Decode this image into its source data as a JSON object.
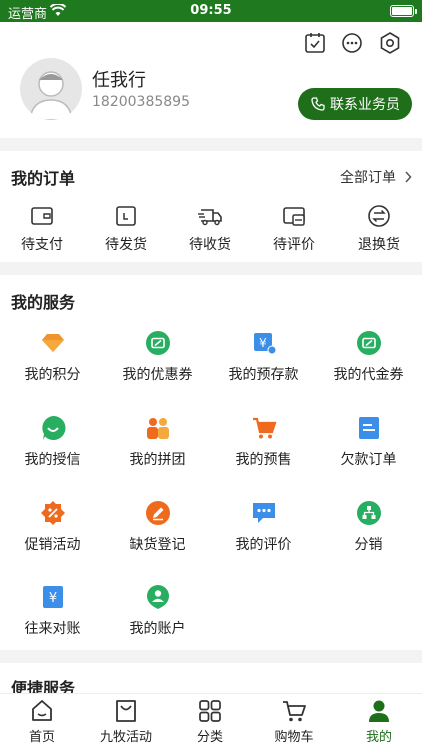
{
  "status_bar": {
    "carrier": "运营商",
    "time": "09:55"
  },
  "profile": {
    "name": "任我行",
    "phone": "18200385895",
    "contact_button": "联系业务员",
    "top_icons": [
      "calendar-check-icon",
      "chat-dots-icon",
      "settings-hexagon-icon"
    ]
  },
  "orders": {
    "title": "我的订单",
    "all_label": "全部订单",
    "items": [
      {
        "label": "待支付",
        "icon": "wallet-icon"
      },
      {
        "label": "待发货",
        "icon": "box-icon"
      },
      {
        "label": "待收货",
        "icon": "truck-icon"
      },
      {
        "label": "待评价",
        "icon": "card-icon"
      },
      {
        "label": "退换货",
        "icon": "exchange-icon"
      }
    ]
  },
  "services": {
    "title": "我的服务",
    "items": [
      {
        "label": "我的积分",
        "icon": "points-diamond-icon",
        "color": "#f0932b"
      },
      {
        "label": "我的优惠券",
        "icon": "coupon-icon",
        "color": "#27ae60"
      },
      {
        "label": "我的预存款",
        "icon": "deposit-icon",
        "color": "#3b8fe8"
      },
      {
        "label": "我的代金券",
        "icon": "voucher-icon",
        "color": "#27ae60"
      },
      {
        "label": "我的授信",
        "icon": "credit-icon",
        "color": "#27ae60"
      },
      {
        "label": "我的拼团",
        "icon": "group-buy-icon",
        "color": "#f0932b"
      },
      {
        "label": "我的预售",
        "icon": "presale-cart-icon",
        "color": "#f06a1d"
      },
      {
        "label": "欠款订单",
        "icon": "debt-order-icon",
        "color": "#3b8fe8"
      },
      {
        "label": "促销活动",
        "icon": "promotion-icon",
        "color": "#f0932b"
      },
      {
        "label": "缺货登记",
        "icon": "stockout-pen-icon",
        "color": "#f06a1d"
      },
      {
        "label": "我的评价",
        "icon": "review-chat-icon",
        "color": "#3b8fe8"
      },
      {
        "label": "分销",
        "icon": "distribution-icon",
        "color": "#27ae60"
      },
      {
        "label": "往来对账",
        "icon": "reconcile-icon",
        "color": "#3b8fe8"
      },
      {
        "label": "我的账户",
        "icon": "account-icon",
        "color": "#27ae60"
      }
    ]
  },
  "quick": {
    "title": "便捷服务"
  },
  "tabs": [
    {
      "label": "首页",
      "icon": "home-icon",
      "active": false
    },
    {
      "label": "九牧活动",
      "icon": "shopping-bag-icon",
      "active": false
    },
    {
      "label": "分类",
      "icon": "category-grid-icon",
      "active": false
    },
    {
      "label": "购物车",
      "icon": "cart-icon",
      "active": false
    },
    {
      "label": "我的",
      "icon": "profile-icon",
      "active": true
    }
  ],
  "colors": {
    "brand_green": "#1f6e1a",
    "status_bar": "#1f7a1f"
  }
}
